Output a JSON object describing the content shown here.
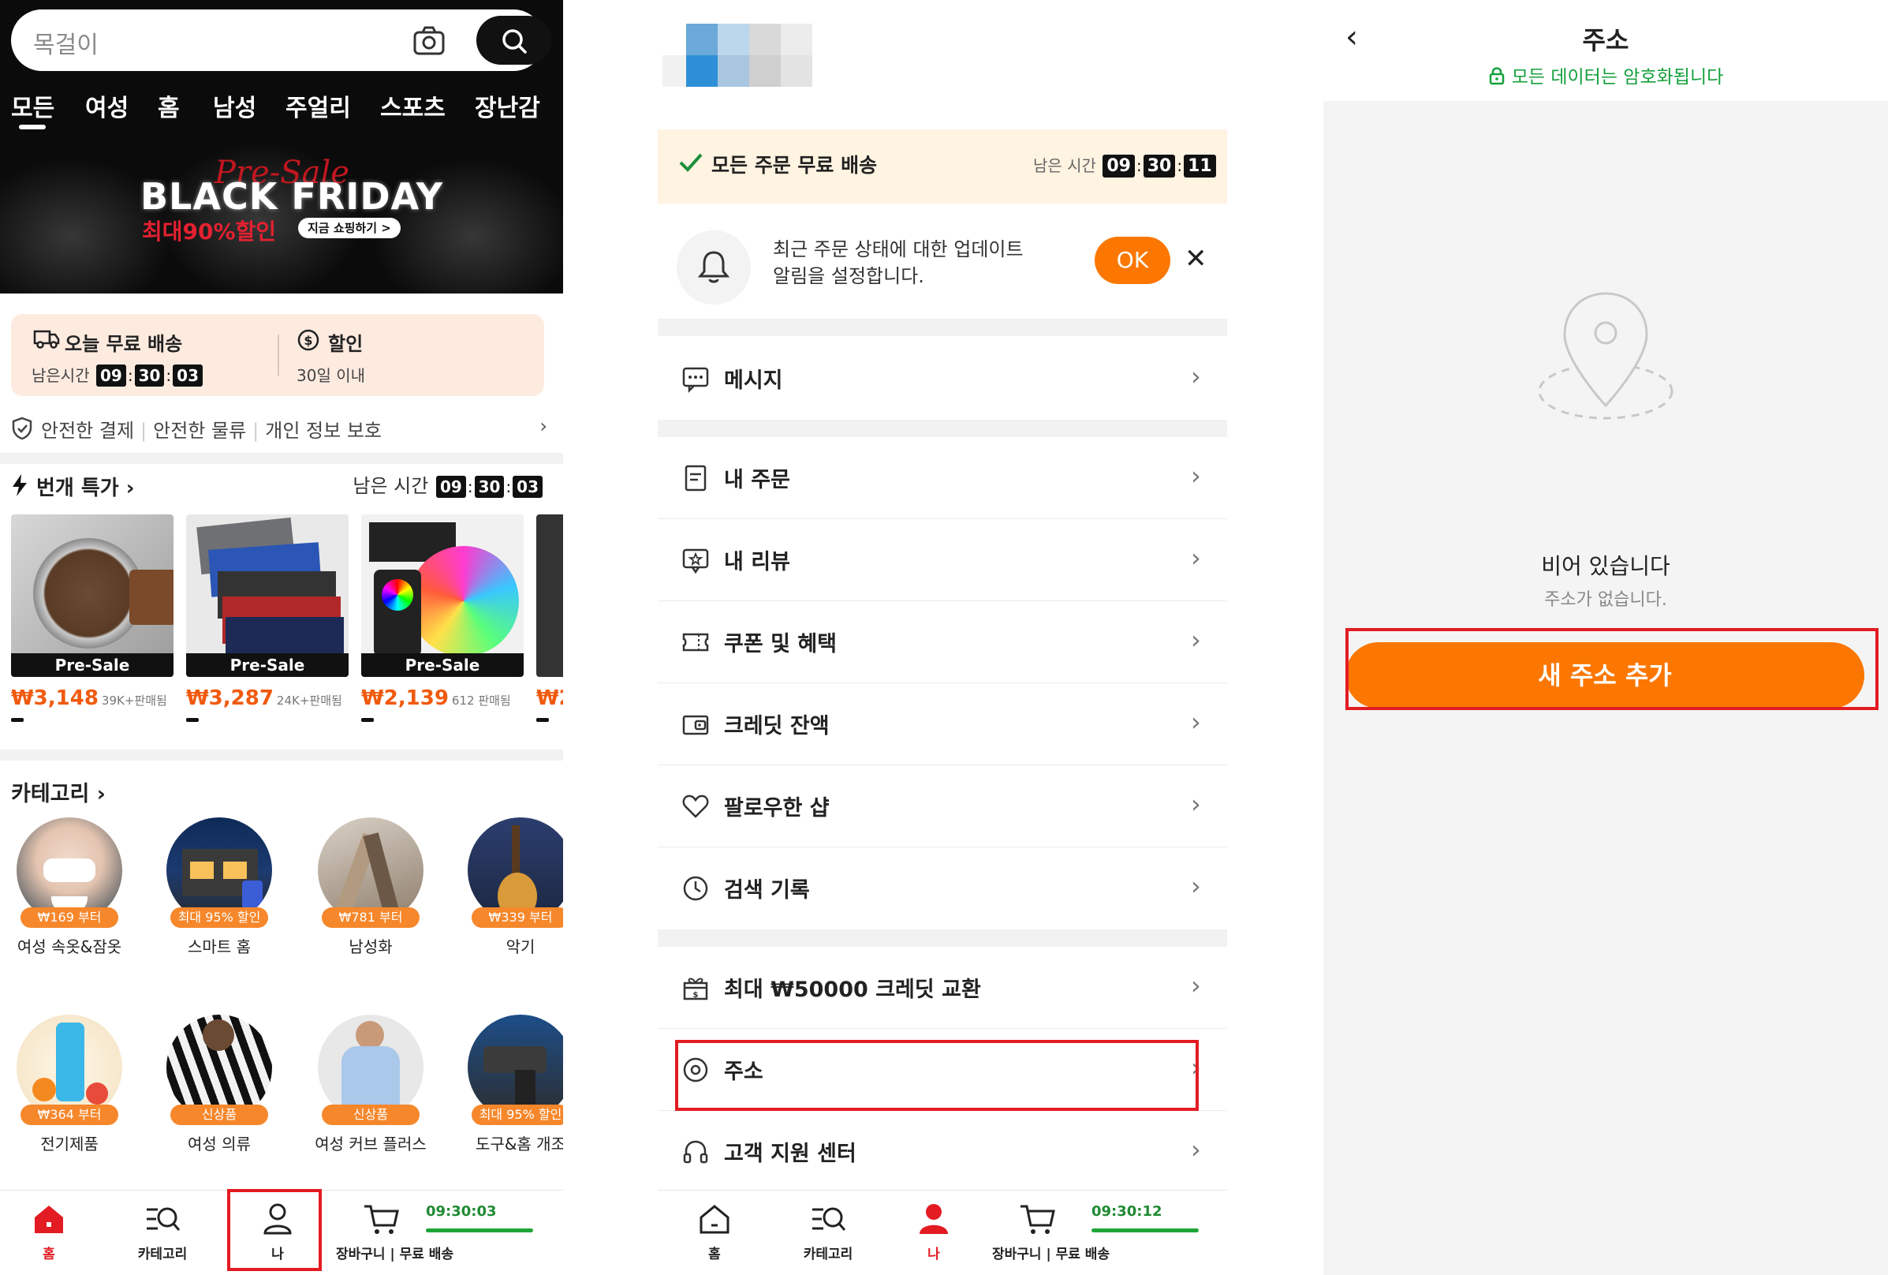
{
  "panel1": {
    "search": {
      "placeholder": "목걸이"
    },
    "category_tabs": [
      "모든",
      "여성",
      "홈",
      "남성",
      "주얼리",
      "스포츠",
      "장난감"
    ],
    "banner": {
      "pre": "Pre-Sale",
      "title": "BLACK FRIDAY",
      "subtitle": "최대90%할인",
      "shop": "지금 쇼핑하기 >"
    },
    "shipping": {
      "left_title": "오늘 무료 배송",
      "left_remaining_label": "남은시간",
      "left_time": [
        "09",
        "30",
        "03"
      ],
      "right_title": "할인",
      "right_sub": "30일 이내"
    },
    "trust": [
      "안전한 결제",
      "안전한 물류",
      "개인 정보 보호"
    ],
    "flash": {
      "title": "번개 특가",
      "remaining_label": "남은 시간",
      "time": [
        "09",
        "30",
        "03"
      ],
      "products": [
        {
          "badge": "Pre-Sale",
          "price": "₩3,148",
          "sold": "39K+판매됨"
        },
        {
          "badge": "Pre-Sale",
          "price": "₩3,287",
          "sold": "24K+판매됨"
        },
        {
          "badge": "Pre-Sale",
          "price": "₩2,139",
          "sold": "612 판매됨"
        },
        {
          "badge": "",
          "price": "₩2",
          "sold": ""
        }
      ]
    },
    "categories_title": "카테고리",
    "categories": [
      {
        "tag": "₩169 부터",
        "label": "여성 속옷&잠옷"
      },
      {
        "tag": "최대 95% 할인",
        "label": "스마트 홈"
      },
      {
        "tag": "₩781 부터",
        "label": "남성화"
      },
      {
        "tag": "₩339 부터",
        "label": "악기"
      },
      {
        "tag": "₩364 부터",
        "label": "전기제품"
      },
      {
        "tag": "신상품",
        "label": "여성 의류"
      },
      {
        "tag": "신상품",
        "label": "여성 커브 플러스"
      },
      {
        "tag": "최대 95% 할인",
        "label": "도구&홈 개조"
      }
    ],
    "tabbar": {
      "home": "홈",
      "category": "카테고리",
      "me": "나",
      "cart": "장바구니 | 무료 배송",
      "cart_time": "09:30:03"
    }
  },
  "panel2": {
    "free_shipping": "모든 주문 무료 배송",
    "remaining_label": "남은 시간",
    "time": [
      "09",
      "30",
      "11"
    ],
    "notice_line1": "최근 주문 상태에 대한 업데이트",
    "notice_line2": "알림을 설정합니다.",
    "ok": "OK",
    "menu": [
      {
        "label": "메시지",
        "icon": "message-icon"
      },
      {
        "label": "내 주문",
        "icon": "order-icon"
      },
      {
        "label": "내 리뷰",
        "icon": "review-icon"
      },
      {
        "label": "쿠폰 및 혜택",
        "icon": "coupon-icon"
      },
      {
        "label": "크레딧 잔액",
        "icon": "wallet-icon"
      },
      {
        "label": "팔로우한 샵",
        "icon": "heart-icon"
      },
      {
        "label": "검색 기록",
        "icon": "clock-icon"
      },
      {
        "label": "최대 ₩50000 크레딧 교환",
        "icon": "gift-icon"
      },
      {
        "label": "주소",
        "icon": "location-icon"
      },
      {
        "label": "고객 지원 센터",
        "icon": "headset-icon"
      }
    ],
    "tabbar": {
      "home": "홈",
      "category": "카테고리",
      "me": "나",
      "cart": "장바구니 | 무료 배송",
      "cart_time": "09:30:12"
    }
  },
  "panel3": {
    "title": "주소",
    "encrypted": "모든 데이터는 암호화됩니다",
    "empty_title": "비어 있습니다",
    "empty_sub": "주소가 없습니다.",
    "add_button": "새 주소 추가"
  },
  "colors": {
    "accent": "#fb7701",
    "highlight": "#e31b23",
    "secure": "#14a03c"
  }
}
